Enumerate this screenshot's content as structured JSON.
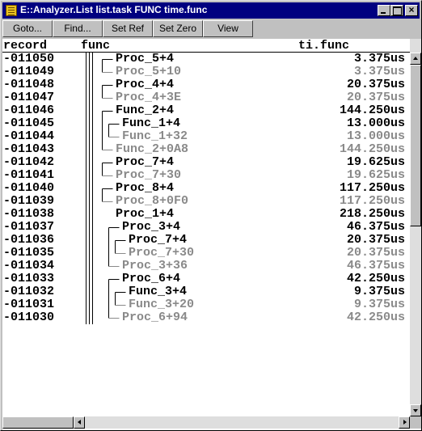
{
  "window": {
    "title": "E::Analyzer.List list.task FUNC time.func"
  },
  "toolbar": {
    "buttons": [
      "Goto...",
      "Find...",
      "Set Ref",
      "Set Zero",
      "View"
    ]
  },
  "columns": {
    "record": "record",
    "func": "func",
    "time": "ti.func"
  },
  "rows": [
    {
      "record": "-011050",
      "func": "Proc_5+4",
      "time": "3.375us",
      "active": true,
      "depth": 0
    },
    {
      "record": "-011049",
      "func": "Proc_5+10",
      "time": "3.375us",
      "active": false,
      "depth": 0
    },
    {
      "record": "-011048",
      "func": "Proc_4+4",
      "time": "20.375us",
      "active": true,
      "depth": 0
    },
    {
      "record": "-011047",
      "func": "Proc_4+3E",
      "time": "20.375us",
      "active": false,
      "depth": 0
    },
    {
      "record": "-011046",
      "func": "Func_2+4",
      "time": "144.250us",
      "active": true,
      "depth": 0
    },
    {
      "record": "-011045",
      "func": "Func_1+4",
      "time": "13.000us",
      "active": true,
      "depth": 1
    },
    {
      "record": "-011044",
      "func": "Func_1+32",
      "time": "13.000us",
      "active": false,
      "depth": 1
    },
    {
      "record": "-011043",
      "func": "Func_2+0A8",
      "time": "144.250us",
      "active": false,
      "depth": 0
    },
    {
      "record": "-011042",
      "func": "Proc_7+4",
      "time": "19.625us",
      "active": true,
      "depth": 0
    },
    {
      "record": "-011041",
      "func": "Proc_7+30",
      "time": "19.625us",
      "active": false,
      "depth": 0
    },
    {
      "record": "-011040",
      "func": "Proc_8+4",
      "time": "117.250us",
      "active": true,
      "depth": 0
    },
    {
      "record": "-011039",
      "func": "Proc_8+0F0",
      "time": "117.250us",
      "active": false,
      "depth": 0
    },
    {
      "record": "-011038",
      "func": "Proc_1+4",
      "time": "218.250us",
      "active": true,
      "depth": 0
    },
    {
      "record": "-011037",
      "func": "Proc_3+4",
      "time": "46.375us",
      "active": true,
      "depth": 1
    },
    {
      "record": "-011036",
      "func": "Proc_7+4",
      "time": "20.375us",
      "active": true,
      "depth": 2
    },
    {
      "record": "-011035",
      "func": "Proc_7+30",
      "time": "20.375us",
      "active": false,
      "depth": 2
    },
    {
      "record": "-011034",
      "func": "Proc_3+36",
      "time": "46.375us",
      "active": false,
      "depth": 1
    },
    {
      "record": "-011033",
      "func": "Proc_6+4",
      "time": "42.250us",
      "active": true,
      "depth": 1
    },
    {
      "record": "-011032",
      "func": "Func_3+4",
      "time": "9.375us",
      "active": true,
      "depth": 2
    },
    {
      "record": "-011031",
      "func": "Func_3+20",
      "time": "9.375us",
      "active": false,
      "depth": 2
    },
    {
      "record": "-011030",
      "func": "Proc_6+94",
      "time": "42.250us",
      "active": false,
      "depth": 1
    }
  ],
  "icons": {
    "app": "analyzer-list-icon",
    "minimize": "minimize-icon",
    "maximize": "maximize-icon",
    "close": "close-icon"
  }
}
